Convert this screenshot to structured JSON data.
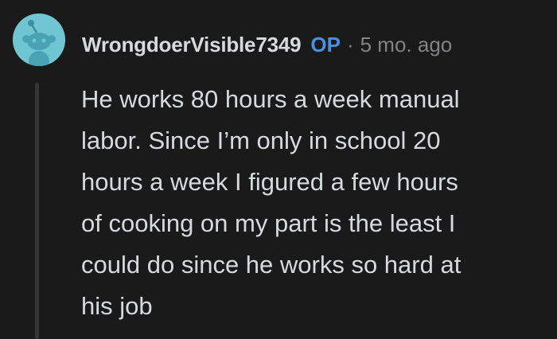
{
  "comment": {
    "author": "WrongdoerVisible7349",
    "op_badge": "OP",
    "separator": "·",
    "timestamp": "5 mo. ago",
    "body": "He works 80 hours a week manual\nlabor. Since I’m only in school 20\nhours a week I figured a few hours\nof cooking on my part is the least I\ncould do since he works so hard at\nhis job",
    "avatar_icon": "snoo-avatar-icon"
  },
  "colors": {
    "background": "#1a1a1b",
    "text": "#d7dadc",
    "meta": "#818384",
    "op": "#4a90e2",
    "avatar_bg": "#6fc6d2",
    "thread_line": "#343536"
  }
}
